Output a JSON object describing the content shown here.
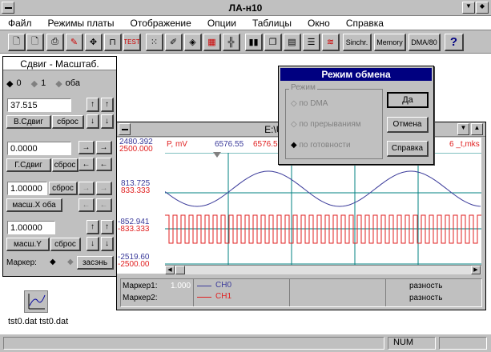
{
  "app": {
    "title": "ЛА-н10"
  },
  "menu": [
    "Файл",
    "Режимы платы",
    "Отображение",
    "Опции",
    "Таблицы",
    "Окно",
    "Справка"
  ],
  "toolbar": {
    "sinchr": "Sinchr.",
    "memory": "Memory",
    "dma": "DMA/80",
    "help": "?"
  },
  "panel": {
    "title": "Сдвиг - Масштаб.",
    "ch_options": [
      "0",
      "1",
      "оба"
    ],
    "shift_value": "37.515",
    "v_shift_btn": "В.Сдвиг",
    "reset1": "сброс",
    "g_value": "0.0000",
    "g_shift_btn": "Г.Сдвиг",
    "reset2": "сброс",
    "scale_value": "1.00000",
    "reset3": "сброс",
    "scale_btn": "масш.Х оба",
    "scale_value2": "1.00000",
    "scale_btn2": "масш.Y",
    "reset4": "сброс",
    "marker_label": "Маркер:",
    "marker_btn": "засэнь"
  },
  "graph": {
    "title": "E:\\ULTRA\\TE",
    "y_labels_blue": [
      "2480.392",
      "813.725",
      "-852.941",
      "-2519.60"
    ],
    "y_labels_red": [
      "2500.000",
      "833.333",
      "-833.333",
      "-2500.00"
    ],
    "unit": "P, mV",
    "marker_vals": [
      "6576.55",
      "6576.551307"
    ],
    "right_hdr": "6 _t,mks",
    "legend": {
      "marker1": "Маркер1:",
      "marker1_val": "1.000",
      "marker2": "Маркер2:",
      "ch0": "CH0",
      "ch1": "CH1",
      "diff1": "разность",
      "diff2": "разность"
    }
  },
  "dialog": {
    "title": "Режим обмена",
    "group": "Режим",
    "options": [
      "по DMA",
      "по прерываниям",
      "по готовности"
    ],
    "btn_ok": "Да",
    "btn_cancel": "Отмена",
    "btn_help": "Справка"
  },
  "desktop_icon": {
    "label": "tst0.dat tst0.dat"
  },
  "status": {
    "num": "NUM"
  },
  "colors": {
    "ch0": "#3a3a9a",
    "ch1": "#e02020",
    "grid": "#008080",
    "dialog_title": "#000080"
  }
}
